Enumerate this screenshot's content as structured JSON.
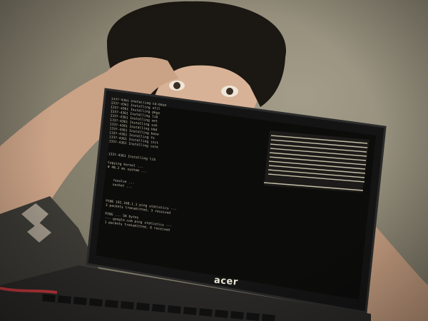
{
  "photo": {
    "subject": "person with tousled dark hair, hands behind head, peeking over an open laptop",
    "tones": {
      "wall": "#8b8573",
      "hair": "#1b1712",
      "skin": "#d9b597",
      "laptop": "#141414",
      "screen_text": "#d9d2b8"
    }
  },
  "laptop": {
    "brand": "acer",
    "screen": {
      "left_pane_lines": [
        "1337-4361 Installing ca-base",
        "1337-4361 Installing util",
        "1337-4361 Installing pkgs",
        "1337-4361 Installing lib",
        "1337-4361 Installing net",
        "1337-4361 Installing ssh",
        "1337-4361 Installing kbd",
        "1337-4361 Installing base",
        "1337-4361 Installing fs",
        "1337-4361 Installing init",
        "1337-4361 Installing core",
        "",
        "",
        "1337-4361 Installing lib",
        "",
        "Copying kernel ...",
        "# 48.2 ms system ...",
        "",
        "",
        "   resolve ...",
        "   socket ...",
        "",
        "",
        "",
        "PING 192.168.1.1 ping statistics ---",
        "3 packets transmitted, 3 received",
        "",
        "PING ... 56 bytes",
        "--- google.com ping statistics ---",
        "1 packets transmitted, 0 received"
      ]
    }
  }
}
